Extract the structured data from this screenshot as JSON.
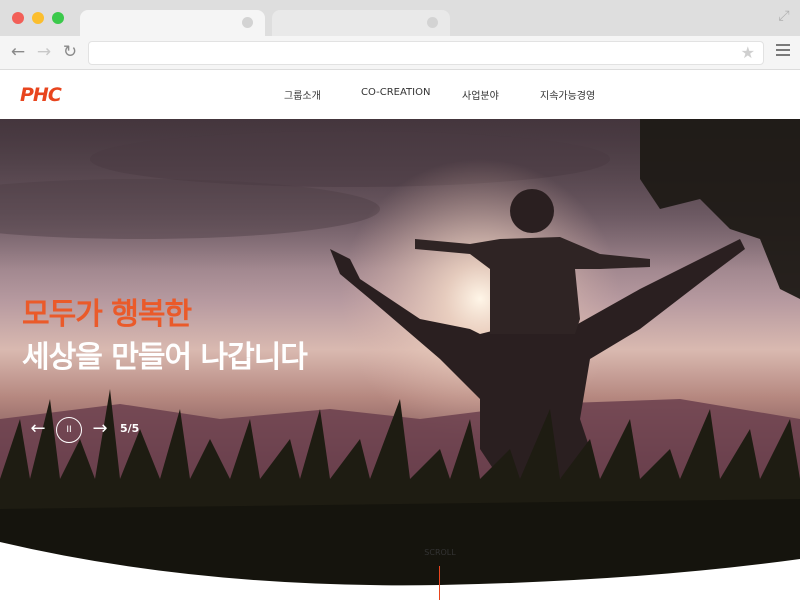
{
  "browser": {
    "address": {
      "value": "",
      "placeholder": ""
    },
    "icons": {
      "back": "arrow-left-icon",
      "forward": "arrow-right-icon",
      "reload": "reload-icon",
      "bookmark": "star-icon",
      "menu": "hamburger-icon",
      "expand": "expand-icon"
    }
  },
  "site": {
    "logo_text": "PHC",
    "nav": {
      "items": [
        {
          "label": "그룹소개"
        },
        {
          "label": "CO-CREATION"
        },
        {
          "label": "사업분야"
        },
        {
          "label": "지속가능경영"
        }
      ]
    },
    "hero": {
      "headline_line1": "모두가 행복한",
      "headline_line2": "세상을 만들어 나갑니다",
      "controls": {
        "prev": "←",
        "pause": "II",
        "next": "→",
        "counter": "5/5"
      },
      "scroll_label": "SCROLL"
    },
    "colors": {
      "brand": "#e8451e",
      "headline_accent": "#ea5a2a",
      "headline_main": "#ffffff"
    }
  }
}
